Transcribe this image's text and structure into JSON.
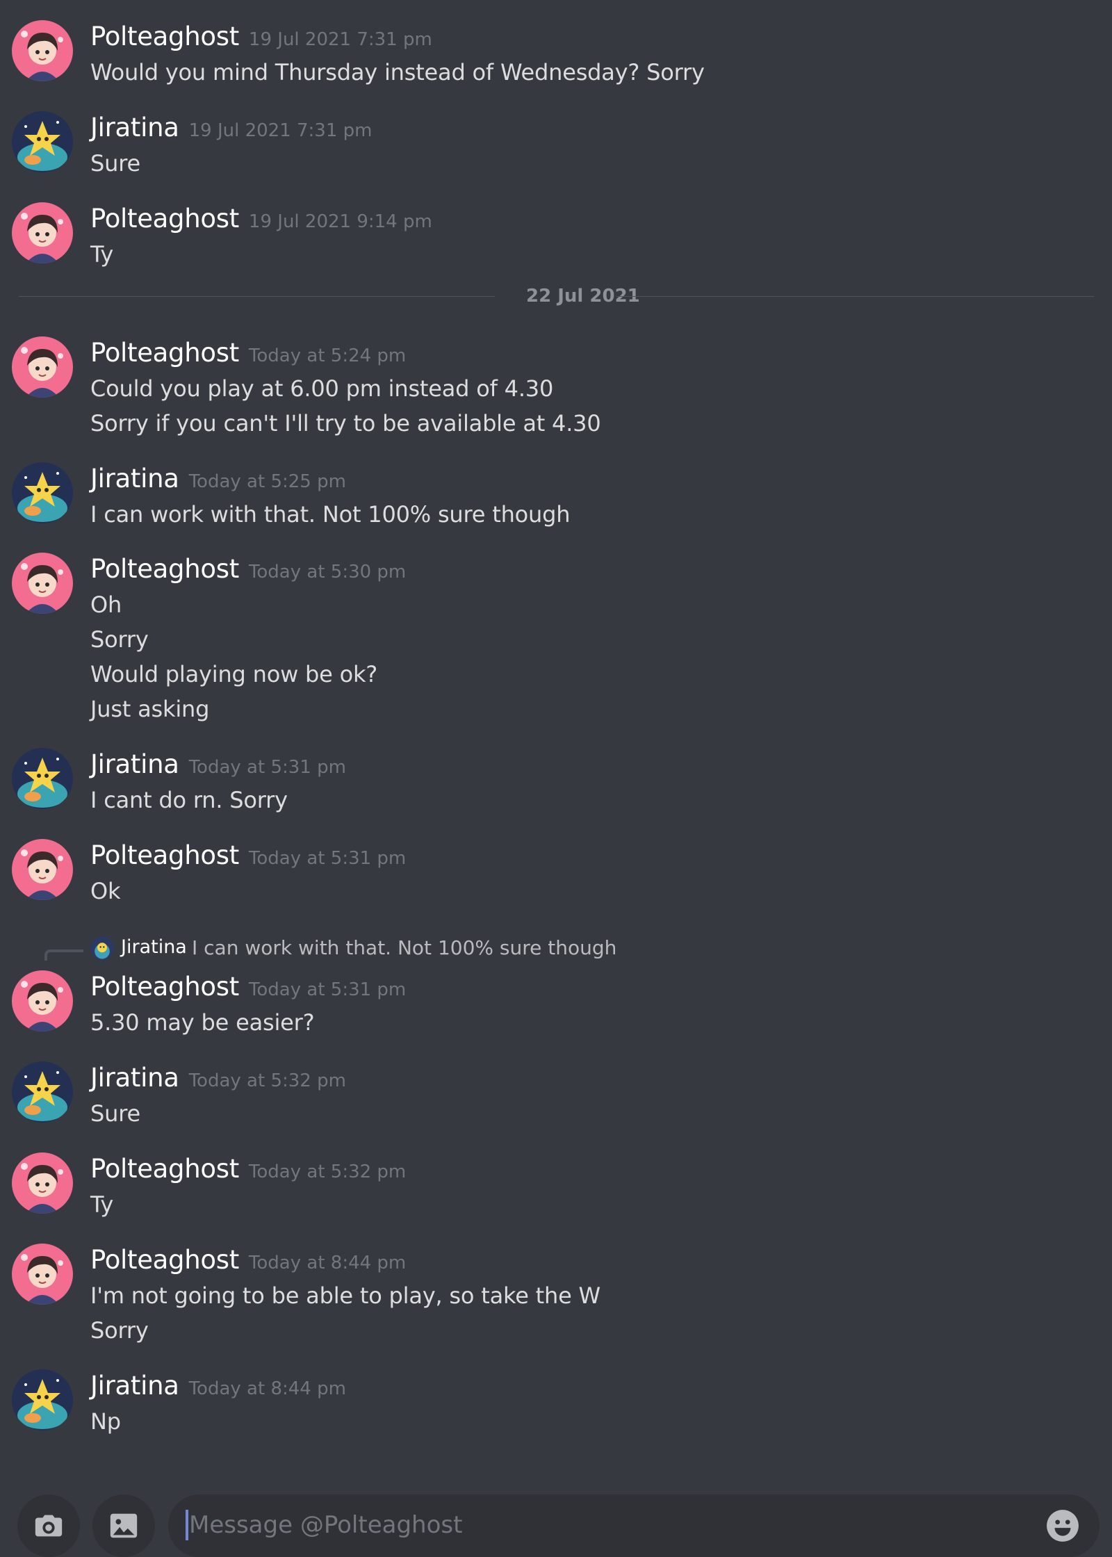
{
  "messages": [
    {
      "author": "Polteaghost",
      "time": "19 Jul 2021 7:31 pm",
      "lines": [
        "Would you mind Thursday instead of Wednesday? Sorry"
      ]
    },
    {
      "author": "Jiratina",
      "time": "19 Jul 2021 7:31 pm",
      "lines": [
        "Sure"
      ]
    },
    {
      "author": "Polteaghost",
      "time": "19 Jul 2021 9:14 pm",
      "lines": [
        "Ty"
      ]
    },
    {
      "author": "Polteaghost",
      "time": "Today at 5:24 pm",
      "lines": [
        "Could you play at 6.00 pm instead of 4.30",
        "Sorry if you can't I'll try to be available at 4.30"
      ]
    },
    {
      "author": "Jiratina",
      "time": "Today at 5:25 pm",
      "lines": [
        "I can work with that. Not 100% sure though"
      ]
    },
    {
      "author": "Polteaghost",
      "time": "Today at 5:30 pm",
      "lines": [
        "Oh",
        "Sorry",
        "Would playing now be ok?",
        "Just asking"
      ]
    },
    {
      "author": "Jiratina",
      "time": "Today at 5:31 pm",
      "lines": [
        "I cant do rn. Sorry"
      ]
    },
    {
      "author": "Polteaghost",
      "time": "Today at 5:31 pm",
      "lines": [
        "Ok"
      ]
    },
    {
      "author": "Polteaghost",
      "time": "Today at 5:31 pm",
      "lines": [
        "5.30 may be easier?"
      ]
    },
    {
      "author": "Jiratina",
      "time": "Today at 5:32 pm",
      "lines": [
        "Sure"
      ]
    },
    {
      "author": "Polteaghost",
      "time": "Today at 5:32 pm",
      "lines": [
        "Ty"
      ]
    },
    {
      "author": "Polteaghost",
      "time": "Today at 8:44 pm",
      "lines": [
        "I'm not going to be able to play, so take the W",
        "Sorry"
      ]
    },
    {
      "author": "Jiratina",
      "time": "Today at 8:44 pm",
      "lines": [
        "Np"
      ]
    }
  ],
  "date_divider": "22 Jul 2021",
  "reply": {
    "author": "Jiratina",
    "text": "I can work with that. Not 100% sure though"
  },
  "composer": {
    "placeholder": "Message @Polteaghost"
  },
  "icons": {
    "camera": "camera-icon",
    "gallery": "image-icon",
    "emoji": "emoji-icon"
  },
  "colors": {
    "background": "#36393f",
    "input": "#2f3136",
    "caret": "#7289da"
  }
}
